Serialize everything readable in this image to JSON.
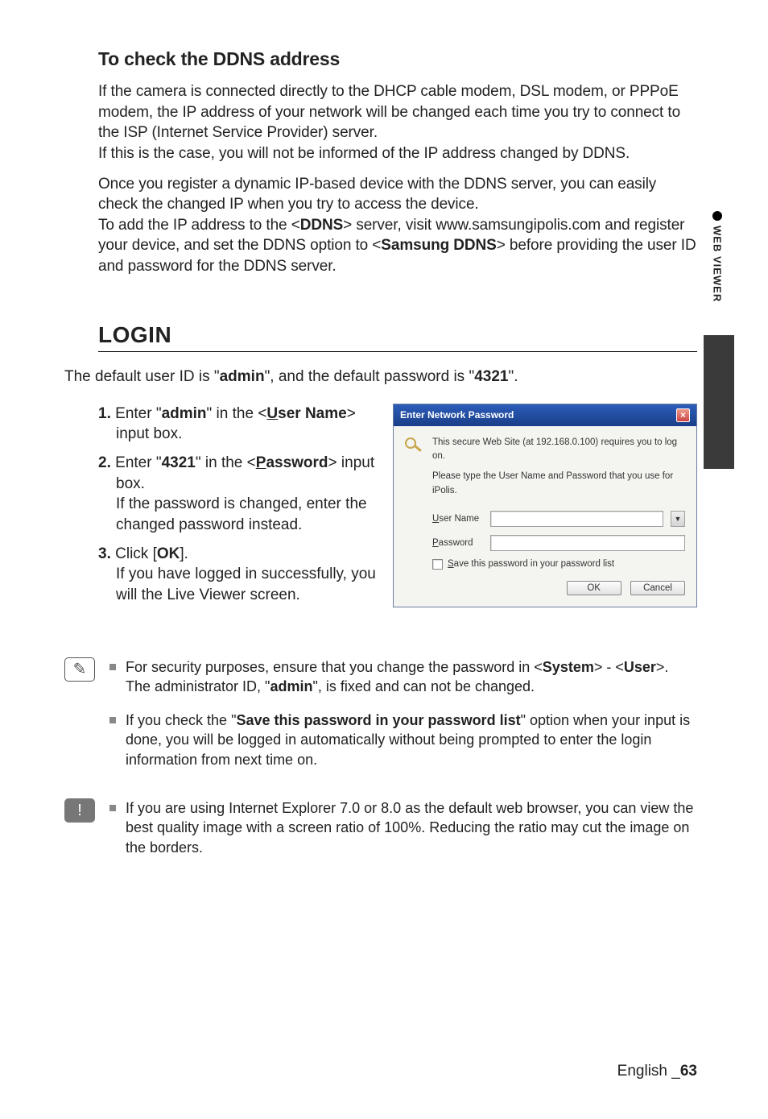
{
  "section1": {
    "heading": "To check the DDNS address",
    "p1_a": "If the camera is connected directly to the DHCP cable modem, DSL modem, or PPPoE modem, the IP address of your network will be changed each time you try to connect to the ISP (Internet Service Provider) server.",
    "p1_b": "If this is the case, you will not be informed of the IP address changed by DDNS.",
    "p2_a": "Once you register a dynamic IP-based device with the DDNS server, you can easily check the changed IP when you try to access the device.",
    "p2_b_pre": "To add the IP address to the <",
    "p2_b_bold1": "DDNS",
    "p2_b_mid": "> server, visit www.samsungipolis.com and register your device, and set the DDNS option to <",
    "p2_b_bold2": "Samsung DDNS",
    "p2_b_post": "> before providing the user ID and password for the DDNS server."
  },
  "login": {
    "heading": "LOGIN",
    "intro_pre": "The default user ID is \"",
    "intro_b1": "admin",
    "intro_mid": "\", and the default password is \"",
    "intro_b2": "4321",
    "intro_post": "\".",
    "steps": {
      "s1": {
        "num": "1.",
        "pre": "Enter \"",
        "b": "admin",
        "mid": "\" in the <",
        "u": "U",
        "upost": "ser Name",
        "post": "> input box."
      },
      "s2": {
        "num": "2.",
        "pre": "Enter \"",
        "b": "4321",
        "mid": "\" in the <",
        "u": "P",
        "upost": "assword",
        "post": "> input box.",
        "line2": "If the password is changed, enter the changed password instead."
      },
      "s3": {
        "num": "3.",
        "pre": "Click [",
        "b": "OK",
        "post": "].",
        "line2": "If you have logged in successfully, you will the Live Viewer screen."
      }
    }
  },
  "dialog": {
    "title": "Enter Network Password",
    "msg1": "This secure Web Site (at 192.168.0.100) requires you to log on.",
    "msg2": "Please type the User Name and Password that you use for iPolis.",
    "user_label": "User Name",
    "pass_label": "Password",
    "save_u": "S",
    "save_rest": "ave this password in your password list",
    "ok": "OK",
    "cancel": "Cancel"
  },
  "notes": {
    "n1_pre": "For security purposes, ensure that you change the password in <",
    "n1_b1": "System",
    "n1_mid": "> - <",
    "n1_b2": "User",
    "n1_post": ">.",
    "n1_line2a": "The administrator ID, \"",
    "n1_line2b": "admin",
    "n1_line2c": "\", is fixed and can not be changed.",
    "n2_pre": "If you check the \"",
    "n2_b": "Save this password in your password list",
    "n2_post": "\" option when your input is done, you will be logged in automatically without being prompted to enter the login information from next time on.",
    "n3": "If you are using Internet Explorer 7.0 or 8.0 as the default web browser, you can view the best quality image with a screen ratio of 100%. Reducing the ratio may cut the image on the borders."
  },
  "side": {
    "label": "WEB VIEWER"
  },
  "footer": {
    "lang": "English",
    "sep": "_",
    "page": "63"
  }
}
